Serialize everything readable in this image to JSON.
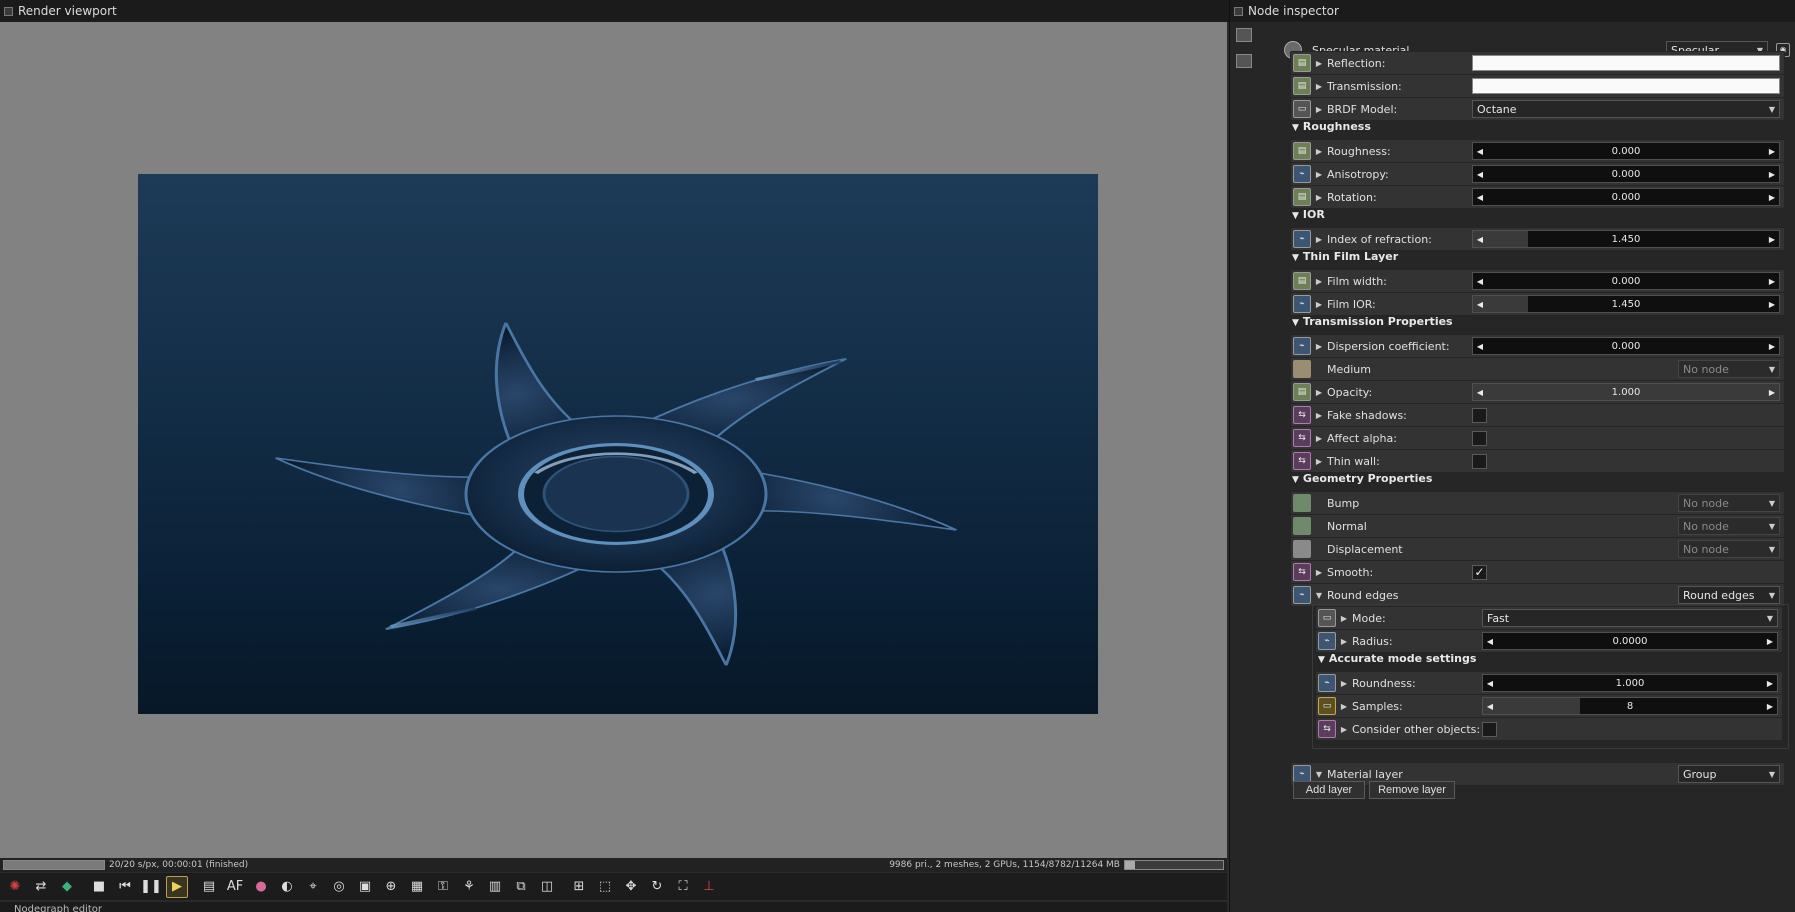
{
  "viewport": {
    "title": "Render viewport",
    "status_text": "20/20 s/px, 00:00:01 (finished)",
    "render_progress": 1.0,
    "stats_text": "9986 pri., 2 meshes, 2 GPUs, 1154/8782/11264 MB",
    "vram_usage": 0.1,
    "nodegraph_title": "Nodegraph editor"
  },
  "toolbar": {
    "icons": [
      "octane-logo-icon",
      "realtime-icon",
      "render-icon",
      "stop-icon",
      "restart-icon",
      "pause-icon",
      "play-icon",
      "display-icon",
      "focus-picker-icon",
      "color-picker-icon",
      "material-picker-icon",
      "object-picker-icon",
      "camera-target-icon",
      "region-icon",
      "zoom-icon",
      "film-region-icon",
      "lock-icon",
      "node-icon",
      "layer-icon",
      "copy-icon",
      "clay-icon",
      "viewport-lock-icon",
      "camera-view-icon",
      "move-icon",
      "rotate-icon",
      "fullscreen-icon",
      "axes-icon"
    ]
  },
  "inspector": {
    "title": "Node inspector",
    "node_name": "Specular material",
    "node_type": "Specular",
    "params": {
      "reflection": {
        "label": "Reflection:",
        "color": "#fafafa"
      },
      "transmission": {
        "label": "Transmission:",
        "color": "#fafafa"
      },
      "brdf": {
        "label": "BRDF Model:",
        "value": "Octane"
      },
      "roughness": {
        "label": "Roughness:",
        "value": "0.000",
        "fill": 0.0
      },
      "anisotropy": {
        "label": "Anisotropy:",
        "value": "0.000",
        "fill": 0.0
      },
      "rotation": {
        "label": "Rotation:",
        "value": "0.000",
        "fill": 0.0
      },
      "ior": {
        "label": "Index of refraction:",
        "value": "1.450",
        "fill": 0.18
      },
      "film_width": {
        "label": "Film width:",
        "value": "0.000",
        "fill": 0.0
      },
      "film_ior": {
        "label": "Film IOR:",
        "value": "1.450",
        "fill": 0.18
      },
      "dispersion": {
        "label": "Dispersion coefficient:",
        "value": "0.000",
        "fill": 0.0
      },
      "medium": {
        "label": "Medium",
        "value": "No node"
      },
      "opacity": {
        "label": "Opacity:",
        "value": "1.000",
        "fill": 1.0
      },
      "fake_shadows": {
        "label": "Fake shadows:",
        "checked": ""
      },
      "affect_alpha": {
        "label": "Affect alpha:",
        "checked": ""
      },
      "thin_wall": {
        "label": "Thin wall:",
        "checked": ""
      },
      "bump": {
        "label": "Bump",
        "value": "No node"
      },
      "normal": {
        "label": "Normal",
        "value": "No node"
      },
      "displacement": {
        "label": "Displacement",
        "value": "No node"
      },
      "smooth": {
        "label": "Smooth:",
        "checked": "✓"
      },
      "round_edges": {
        "label": "Round edges",
        "value": "Round edges"
      },
      "mode": {
        "label": "Mode:",
        "value": "Fast"
      },
      "radius": {
        "label": "Radius:",
        "value": "0.0000",
        "fill": 0.0
      },
      "roundness": {
        "label": "Roundness:",
        "value": "1.000",
        "fill": 0.0
      },
      "samples": {
        "label": "Samples:",
        "value": "8",
        "fill": 0.33
      },
      "consider_other": {
        "label": "Consider other objects:",
        "checked": ""
      },
      "material_layer": {
        "label": "Material layer",
        "value": "Group"
      }
    },
    "sections": {
      "roughness": "Roughness",
      "ior": "IOR",
      "thin_film": "Thin Film Layer",
      "transmission": "Transmission Properties",
      "geometry": "Geometry Properties",
      "accurate": "Accurate mode settings"
    },
    "buttons": {
      "add_layer": "Add layer",
      "remove_layer": "Remove layer"
    }
  }
}
